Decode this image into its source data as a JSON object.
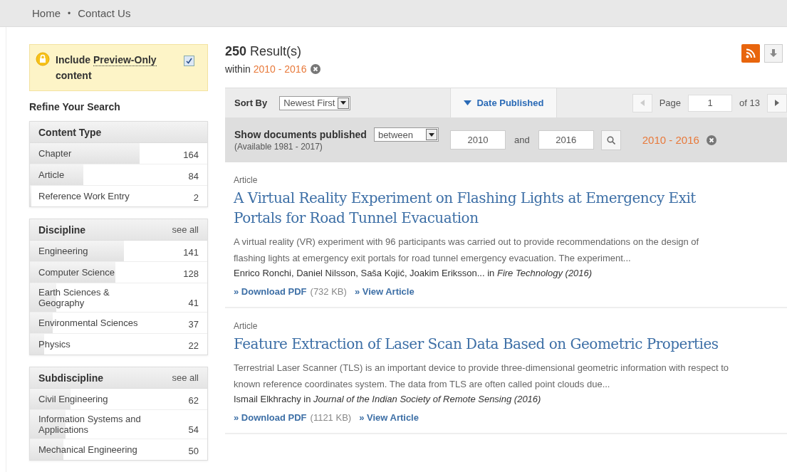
{
  "nav": {
    "links": [
      "Home",
      "Contact Us"
    ],
    "separator": "•"
  },
  "preview": {
    "label_start": "Include ",
    "link": "Preview-Only",
    "label_end": "content",
    "checked": true
  },
  "refine_title": "Refine Your Search",
  "facets": [
    {
      "title": "Content Type",
      "items": [
        {
          "label": "Chapter",
          "count": "164",
          "level": 0.62
        },
        {
          "label": "Article",
          "count": "84",
          "level": 0.3
        },
        {
          "label": "Reference Work Entry",
          "count": "2",
          "level": 0.01
        }
      ]
    },
    {
      "title": "Discipline",
      "see_all": "see all",
      "items": [
        {
          "label": "Engineering",
          "count": "141",
          "level": 0.53
        },
        {
          "label": "Computer Science",
          "count": "128",
          "level": 0.48
        },
        {
          "label": "Earth Sciences & Geography",
          "count": "41",
          "level": 0.15
        },
        {
          "label": "Environmental Sciences",
          "count": "37",
          "level": 0.13
        },
        {
          "label": "Physics",
          "count": "22",
          "level": 0.08
        }
      ]
    },
    {
      "title": "Subdiscipline",
      "see_all": "see all",
      "items": [
        {
          "label": "Civil Engineering",
          "count": "62",
          "level": 0.23
        },
        {
          "label": "Information Systems and Applications",
          "count": "54",
          "level": 0.2
        },
        {
          "label": "Mechanical Engineering",
          "count": "50",
          "level": 0.19
        }
      ]
    }
  ],
  "results": {
    "count": "250",
    "label": "Result(s)",
    "within": "within",
    "range": "2010 - 2016"
  },
  "toolbar": {
    "sort_label": "Sort By",
    "sort_value": "Newest First",
    "tabs": [
      {
        "label": "Date Published",
        "selected": true
      }
    ],
    "page_label": "Page",
    "page_value": "1",
    "page_of": "of 13",
    "prev_disabled": true,
    "next_disabled": false
  },
  "date_filter": {
    "label": "Show documents published",
    "available": "(Available 1981 - 2017)",
    "mode": "between",
    "from": "2010",
    "and": "and",
    "to": "2016",
    "active_range": "2010 - 2016"
  },
  "articles": [
    {
      "type": "Article",
      "title": "A Virtual Reality Experiment on Flashing Lights at Emergency Exit Portals for Road Tunnel Evacuation",
      "snippet": "A virtual reality (VR) experiment with 96 participants was carried out to provide recommendations on the design of flashing lights at emergency exit portals for road tunnel emergency evacuation. The experiment...",
      "authors": "Enrico Ronchi, Daniel Nilsson, Saša Kojić, Joakim Eriksson... in *Fire Technology (2016)*",
      "download": "» Download PDF",
      "size": "(732 KB)",
      "view": "» View Article"
    },
    {
      "type": "Article",
      "title": "Feature Extraction of Laser Scan Data Based on Geometric Properties",
      "snippet": "Terrestrial Laser Scanner (TLS) is an important device to provide three-dimensional geometric information with respect to known reference coordinates system. The data from TLS are often called point clouds due...",
      "authors": "Ismail Elkhrachy in *Journal of the Indian Society of Remote Sensing (2016)*",
      "download": "» Download PDF",
      "size": "(1121 KB)",
      "view": "» View Article"
    }
  ]
}
